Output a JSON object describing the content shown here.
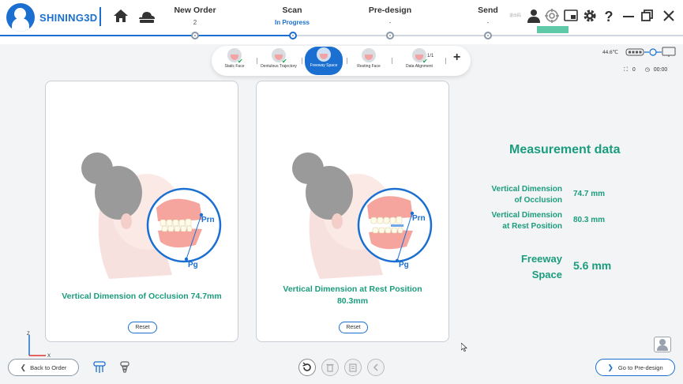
{
  "app": {
    "brand": "SHINING3D"
  },
  "steps": [
    {
      "title": "New Order",
      "sub": "2"
    },
    {
      "title": "Scan",
      "sub": "In Progress"
    },
    {
      "title": "Pre-design",
      "sub": "-"
    },
    {
      "title": "Send",
      "sub": "-"
    }
  ],
  "header": {
    "tiny_label": "退出码"
  },
  "capture": {
    "items": [
      {
        "label": "Static Face"
      },
      {
        "label": "Dentulous Trajectory"
      },
      {
        "label": "Freeway Space"
      },
      {
        "label": "Resting Face"
      },
      {
        "label": "Data Alignment"
      }
    ],
    "count": "1/1",
    "add": "+"
  },
  "status": {
    "temperature": "44.6℃",
    "counter": "0",
    "time": "00:00"
  },
  "cards": [
    {
      "label": "Vertical Dimension of Occlusion  74.7mm",
      "reset": "Reset",
      "point_top": "Prn",
      "point_bottom": "Pg"
    },
    {
      "label": "Vertical Dimension at Rest Position",
      "label2": "80.3mm",
      "reset": "Reset",
      "point_top": "Prn",
      "point_bottom": "Pg"
    }
  ],
  "measurement": {
    "title": "Measurement data",
    "rows": [
      {
        "label1": "Vertical Dimension",
        "label2": "of Occlusion",
        "value": "74.7 mm"
      },
      {
        "label1": "Vertical Dimension",
        "label2": "at Rest Position",
        "value": "80.3 mm"
      },
      {
        "label1": "Freeway",
        "label2": "Space",
        "value": "5.6 mm"
      }
    ]
  },
  "axis": {
    "z": "Z",
    "x": "X"
  },
  "footer": {
    "back": "Back to Order",
    "next": "Go to Pre-design"
  },
  "colors": {
    "brand": "#1a6fd0",
    "accent": "#1b9c7d",
    "highlight": "#5fc9a8"
  }
}
